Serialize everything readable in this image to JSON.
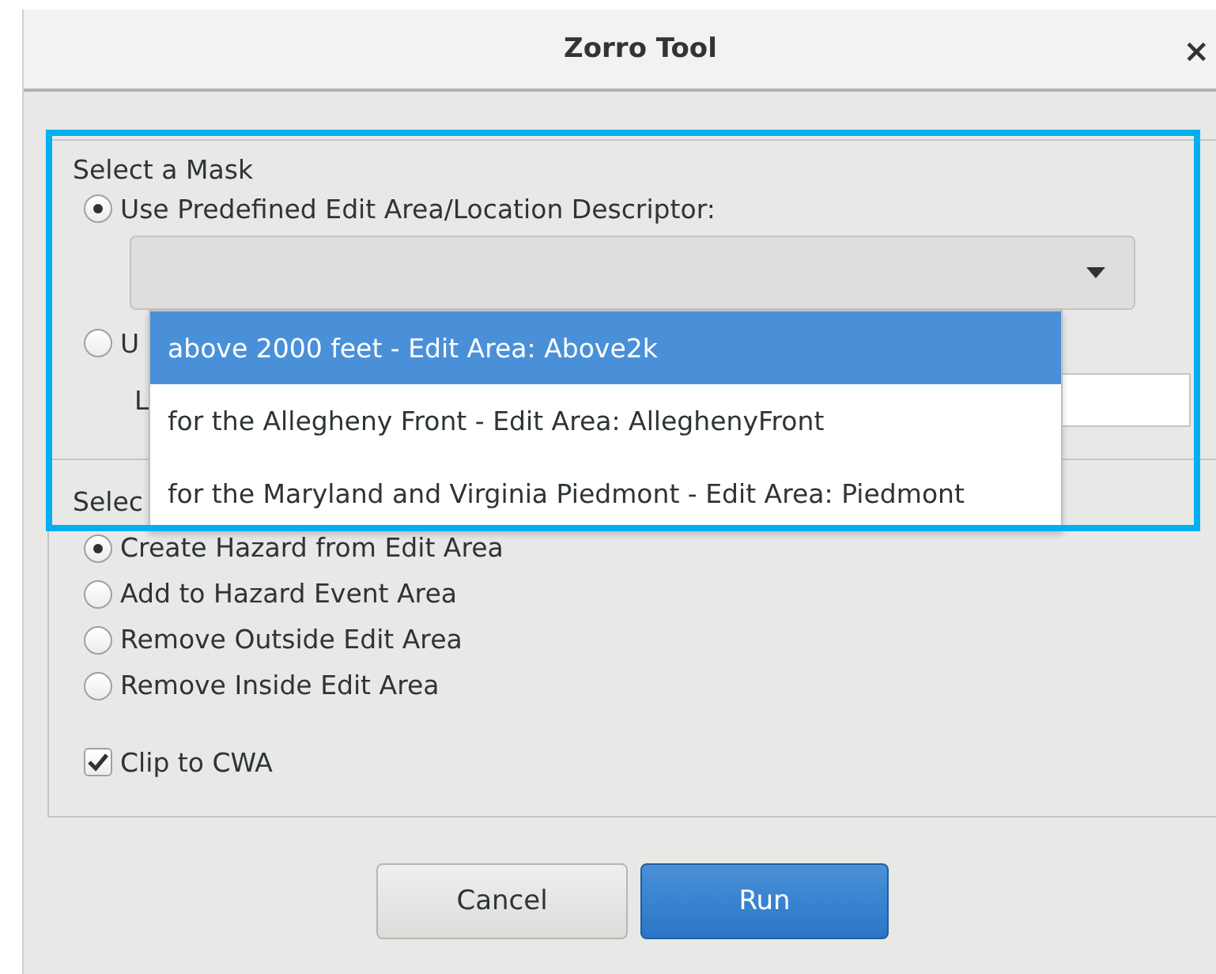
{
  "window": {
    "title": "Zorro Tool",
    "close_glyph": "×"
  },
  "mask_group": {
    "title": "Select a Mask",
    "options": [
      {
        "label": "Use Predefined Edit Area/Location Descriptor:",
        "selected": true
      },
      {
        "label": "U",
        "selected": false
      }
    ],
    "dropdown": {
      "expanded": true,
      "items": [
        {
          "label": "above 2000 feet - Edit Area: Above2k",
          "selected": true
        },
        {
          "label": "for the Allegheny Front - Edit Area: AlleghenyFront",
          "selected": false
        },
        {
          "label": "for the Maryland and Virginia Piedmont - Edit Area: Piedmont",
          "selected": false
        }
      ]
    },
    "location_label": "L"
  },
  "hazard_group": {
    "title": "Selec",
    "options": [
      {
        "label": "Create Hazard from Edit Area",
        "selected": true
      },
      {
        "label": "Add to Hazard Event Area",
        "selected": false
      },
      {
        "label": "Remove Outside Edit Area",
        "selected": false
      },
      {
        "label": "Remove Inside Edit Area",
        "selected": false
      }
    ],
    "clip": {
      "label": "Clip to CWA",
      "checked": true
    }
  },
  "buttons": [
    {
      "label": "Cancel",
      "kind": "secondary"
    },
    {
      "label": "Run",
      "kind": "primary"
    }
  ]
}
